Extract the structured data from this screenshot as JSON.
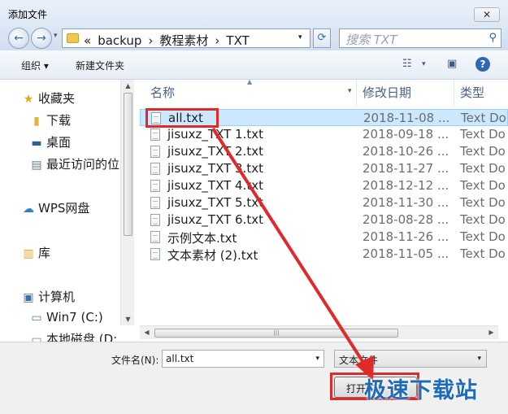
{
  "window": {
    "title": "添加文件",
    "close_label": "✕"
  },
  "address_bar": {
    "breadcrumb": [
      "«",
      "backup",
      "›",
      "教程素材",
      "›",
      "TXT"
    ],
    "search_placeholder": "搜索 TXT"
  },
  "toolbar": {
    "organize_label": "组织 ▾",
    "new_folder_label": "新建文件夹"
  },
  "nav_pane": {
    "items": [
      {
        "label": "收藏夹",
        "icon": "star-icon"
      },
      {
        "label": "下载",
        "icon": "folder-icon"
      },
      {
        "label": "桌面",
        "icon": "desktop-icon"
      },
      {
        "label": "最近访问的位",
        "icon": "recent-icon"
      },
      {
        "label": "WPS网盘",
        "icon": "cloud-icon"
      },
      {
        "label": "库",
        "icon": "library-icon"
      },
      {
        "label": "计算机",
        "icon": "computer-icon"
      },
      {
        "label": "Win7 (C:)",
        "icon": "drive-icon"
      },
      {
        "label": "本地磁盘 (D:",
        "icon": "drive-icon"
      }
    ]
  },
  "file_list": {
    "columns": [
      "名称",
      "修改日期",
      "类型"
    ],
    "files": [
      {
        "name": "all.txt",
        "date": "2018-11-08 ...",
        "type": "Text Do",
        "selected": true
      },
      {
        "name": "jisuxz_TXT 1.txt",
        "date": "2018-09-18 ...",
        "type": "Text Do",
        "selected": false
      },
      {
        "name": "jisuxz_TXT 2.txt",
        "date": "2018-10-26 ...",
        "type": "Text Do",
        "selected": false
      },
      {
        "name": "jisuxz_TXT 3.txt",
        "date": "2018-11-27 ...",
        "type": "Text Do",
        "selected": false
      },
      {
        "name": "jisuxz_TXT 4.txt",
        "date": "2018-12-12 ...",
        "type": "Text Do",
        "selected": false
      },
      {
        "name": "jisuxz_TXT 5.txt",
        "date": "2018-11-30 ...",
        "type": "Text Do",
        "selected": false
      },
      {
        "name": "jisuxz_TXT 6.txt",
        "date": "2018-08-28 ...",
        "type": "Text Do",
        "selected": false
      },
      {
        "name": "示例文本.txt",
        "date": "2018-11-26 ...",
        "type": "Text Do",
        "selected": false
      },
      {
        "name": "文本素材 (2).txt",
        "date": "2018-11-05 ...",
        "type": "Text Do",
        "selected": false
      }
    ]
  },
  "bottom": {
    "filename_label": "文件名(N):",
    "filename_value": "all.txt",
    "filetype_value": "文本文件",
    "open_label": "打开(O)"
  },
  "annotation": {
    "color": "#e02a2a"
  },
  "watermark": "极速下载站"
}
